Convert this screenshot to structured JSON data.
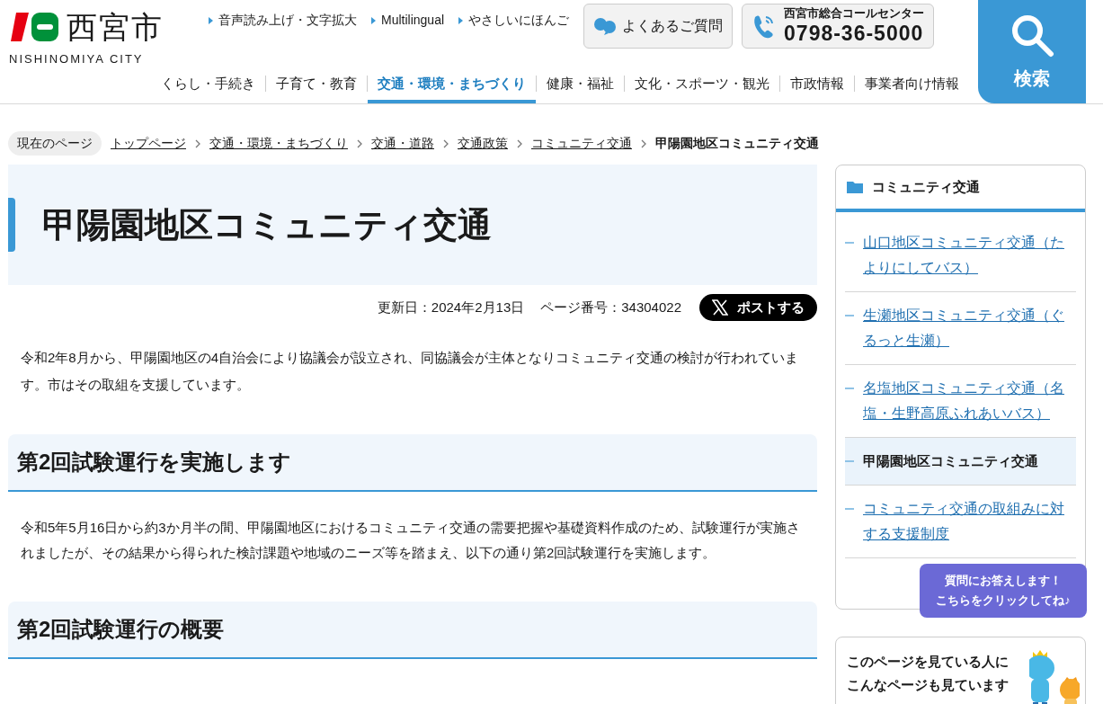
{
  "header": {
    "logo": {
      "name": "西宮市",
      "sub": "NISHINOMIYA CITY"
    },
    "utility_links": [
      "音声読み上げ・文字拡大",
      "Multilingual",
      "やさしいにほんご"
    ],
    "faq_button": "よくあるご質問",
    "call_center": {
      "label": "西宮市総合コールセンター",
      "phone": "0798-36-5000"
    },
    "search_button": "検索"
  },
  "nav": [
    {
      "label": "くらし・手続き",
      "selected": false
    },
    {
      "label": "子育て・教育",
      "selected": false
    },
    {
      "label": "交通・環境・まちづくり",
      "selected": true
    },
    {
      "label": "健康・福祉",
      "selected": false
    },
    {
      "label": "文化・スポーツ・観光",
      "selected": false
    },
    {
      "label": "市政情報",
      "selected": false
    },
    {
      "label": "事業者向け情報",
      "selected": false
    }
  ],
  "breadcrumb": {
    "label": "現在のページ",
    "items": [
      {
        "text": "トップページ",
        "current": false
      },
      {
        "text": "交通・環境・まちづくり",
        "current": false
      },
      {
        "text": "交通・道路",
        "current": false
      },
      {
        "text": "交通政策",
        "current": false
      },
      {
        "text": "コミュニティ交通",
        "current": false
      },
      {
        "text": "甲陽園地区コミュニティ交通",
        "current": true
      }
    ]
  },
  "page": {
    "title": "甲陽園地区コミュニティ交通",
    "updated": "更新日：2024年2月13日",
    "page_number": "ページ番号：34304022",
    "share_button": "ポストする",
    "intro": "令和2年8月から、甲陽園地区の4自治会により協議会が設立され、同協議会が主体となりコミュニティ交通の検討が行われています。市はその取組を支援しています。",
    "sections": [
      {
        "heading": "第2回試験運行を実施します",
        "body": "令和5年5月16日から約3か月半の間、甲陽園地区におけるコミュニティ交通の需要把握や基礎資料作成のため、試験運行が実施されましたが、その結果から得られた検討課題や地域のニーズ等を踏まえ、以下の通り第2回試験運行を実施します。"
      },
      {
        "heading": "第2回試験運行の概要"
      }
    ]
  },
  "sidebar": {
    "heading": "コミュニティ交通",
    "items": [
      {
        "text": "山口地区コミュニティ交通（たよりにしてバス）",
        "selected": false
      },
      {
        "text": "生瀬地区コミュニティ交通（ぐるっと生瀬）",
        "selected": false
      },
      {
        "text": "名塩地区コミュニティ交通（名塩・生野高原ふれあいバス）",
        "selected": false
      },
      {
        "text": "甲陽園地区コミュニティ交通",
        "selected": true
      },
      {
        "text": "コミュニティ交通の取組みに対する支援制度",
        "selected": false
      }
    ]
  },
  "related": {
    "heading": "このページを見ている人にこんなページも見ています"
  },
  "chat_bubble": {
    "lines": [
      "質問にお答えします！",
      "こちらをクリックしてね♪"
    ]
  }
}
